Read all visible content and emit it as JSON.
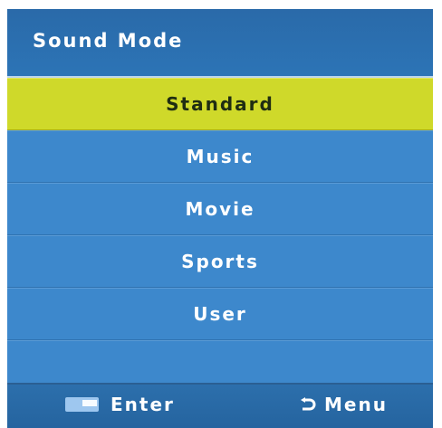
{
  "header": {
    "title": "Sound Mode"
  },
  "menu": {
    "items": [
      {
        "label": "Standard",
        "selected": true
      },
      {
        "label": "Music",
        "selected": false
      },
      {
        "label": "Movie",
        "selected": false
      },
      {
        "label": "Sports",
        "selected": false
      },
      {
        "label": "User",
        "selected": false
      }
    ]
  },
  "footer": {
    "enter_label": "Enter",
    "menu_label": "Menu",
    "enter_icon": "enter-key-icon",
    "menu_icon": "return-arrow-icon"
  },
  "colors": {
    "panel_blue": "#3a85c9",
    "header_blue": "#2a6aa9",
    "selected_highlight": "#cfd92a",
    "text": "#ffffff"
  }
}
